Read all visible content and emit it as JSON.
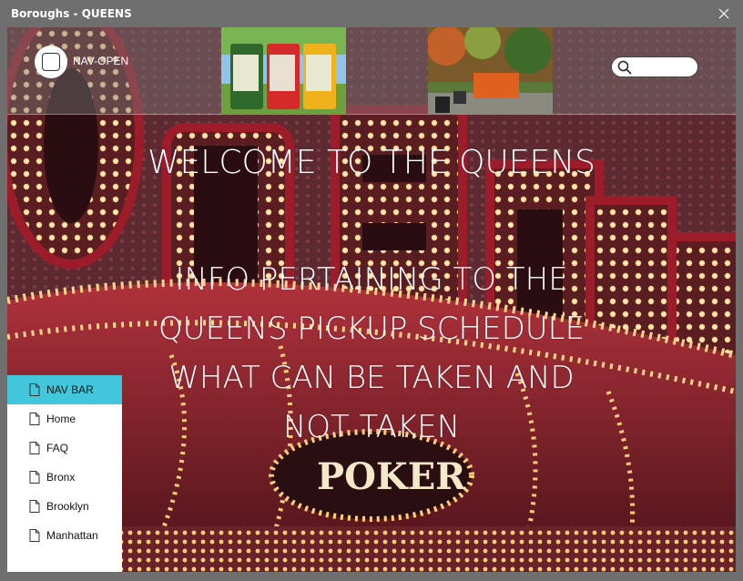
{
  "window": {
    "title": "Boroughs - QUEENS"
  },
  "topbar": {
    "nav_open_label": "NAV-OPEN",
    "search": {
      "value": "",
      "placeholder": ""
    },
    "images": [
      "recycling-bins-image",
      "waste-truck-image"
    ]
  },
  "main": {
    "welcome": "WELCOME TO THE QUEENS",
    "info_lines": [
      "INFO PERTAINING TO THE",
      "QUEENS PICKUP SCHEDULE",
      "WHAT CAN BE TAKEN AND",
      "NOT TAKEN"
    ],
    "background_sign": "POKER"
  },
  "navpane": {
    "items": [
      {
        "label": "NAV BAR",
        "active": true
      },
      {
        "label": "Home",
        "active": false
      },
      {
        "label": "FAQ",
        "active": false
      },
      {
        "label": "Bronx",
        "active": false
      },
      {
        "label": "Brooklyn",
        "active": false
      },
      {
        "label": "Manhattan",
        "active": false
      }
    ]
  },
  "colors": {
    "nav_active": "#42c6dc",
    "titlebar": "#6f6f6f",
    "marquee_red": "#8a1a24",
    "bulb": "#ffd88a"
  }
}
